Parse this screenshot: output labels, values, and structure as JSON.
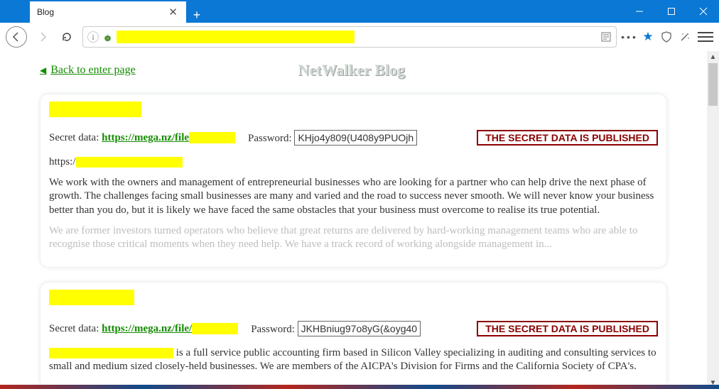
{
  "window": {
    "tab_title": "Blog",
    "close_glyph": "✕",
    "plus_glyph": "+"
  },
  "nav": {
    "back": "←",
    "forward": "→",
    "reload": "⟳"
  },
  "urlbar": {
    "info_glyph": "i",
    "reader_glyph": "▤",
    "more_glyph": "•••",
    "star_glyph": "★"
  },
  "page": {
    "back_link_arrow": "◀",
    "back_link_text": "Back to enter page",
    "title": "NetWalker Blog"
  },
  "entries": [
    {
      "secret_label": "Secret data:",
      "secret_link": "https://mega.nz/file",
      "password_label": "Password:",
      "password_value": "KHjo4y809(U408y9PUOjh",
      "published_badge": "THE SECRET DATA IS PUBLISHED",
      "url_prefix": "https:/",
      "para1": "We work with the owners and management of entrepreneurial businesses who are looking for a partner who can help drive the next phase of growth. The challenges facing small businesses are many and varied and the road to success never smooth. We will never know your business better than you do, but it is likely we have faced the same obstacles that your business must overcome to realise its true potential.",
      "para2": "We are former investors turned operators who believe that great returns are delivered by hard-working management teams who are able to recognise those critical moments when they need help. We have a track record of working alongside management in..."
    },
    {
      "secret_label": "Secret data:",
      "secret_link": "https://mega.nz/file/",
      "password_label": "Password:",
      "password_value": "JKHBniug97o8yG(&oyg40",
      "published_badge": "THE SECRET DATA IS PUBLISHED",
      "para1a": " is a full service public accounting firm based in Silicon Valley specializing in auditing and consulting services to small and medium sized closely-held businesses. We are members of the AICPA's Division for Firms and the California Society of CPA's."
    }
  ],
  "scrollbar": {
    "up": "▲",
    "down": "▼"
  }
}
